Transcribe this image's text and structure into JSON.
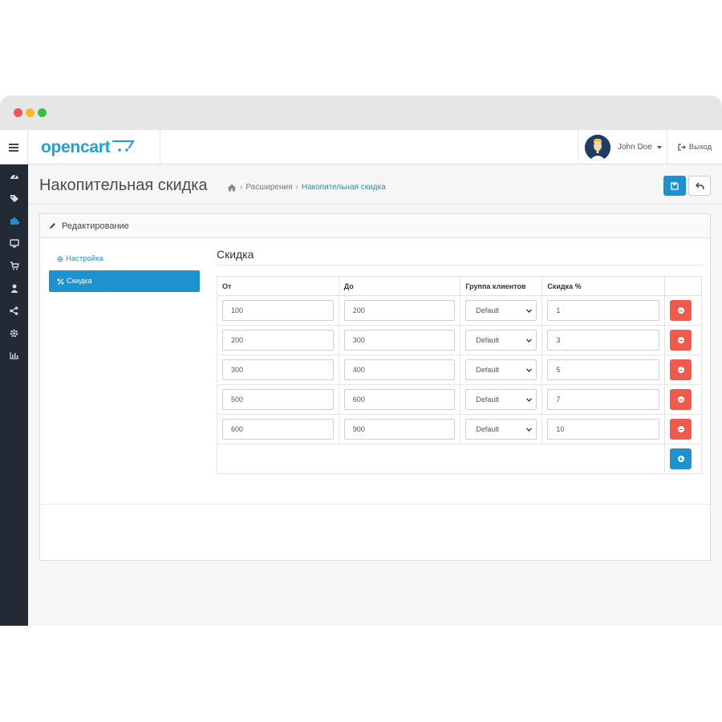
{
  "header": {
    "logo_text": "opencart",
    "user_name": "John Doe",
    "logout_label": "Выход"
  },
  "sidebar": {
    "icons": [
      "dashboard-icon",
      "tags-icon",
      "puzzle-icon",
      "desktop-icon",
      "cart-icon",
      "user-icon",
      "share-icon",
      "cog-icon",
      "bar-chart-icon"
    ]
  },
  "page": {
    "title": "Накопительная скидка",
    "breadcrumb": [
      "Расширения",
      "Накопительная скидка"
    ]
  },
  "panel": {
    "heading": "Редактирование",
    "tabs": [
      {
        "label": "Настройка",
        "active": false
      },
      {
        "label": "Скидка",
        "active": true
      }
    ],
    "section_title": "Скидка"
  },
  "table": {
    "headers": [
      "От",
      "До",
      "Группа клиентов",
      "Скидка %"
    ],
    "rows": [
      {
        "from": "100",
        "to": "200",
        "group": "Default",
        "discount": "1"
      },
      {
        "from": "200",
        "to": "300",
        "group": "Default",
        "discount": "3"
      },
      {
        "from": "300",
        "to": "400",
        "group": "Default",
        "discount": "5"
      },
      {
        "from": "500",
        "to": "600",
        "group": "Default",
        "discount": "7"
      },
      {
        "from": "600",
        "to": "900",
        "group": "Default",
        "discount": "10"
      }
    ]
  },
  "colors": {
    "primary": "#1e91cf",
    "danger": "#f05a4c",
    "sidebar": "#232a35"
  }
}
